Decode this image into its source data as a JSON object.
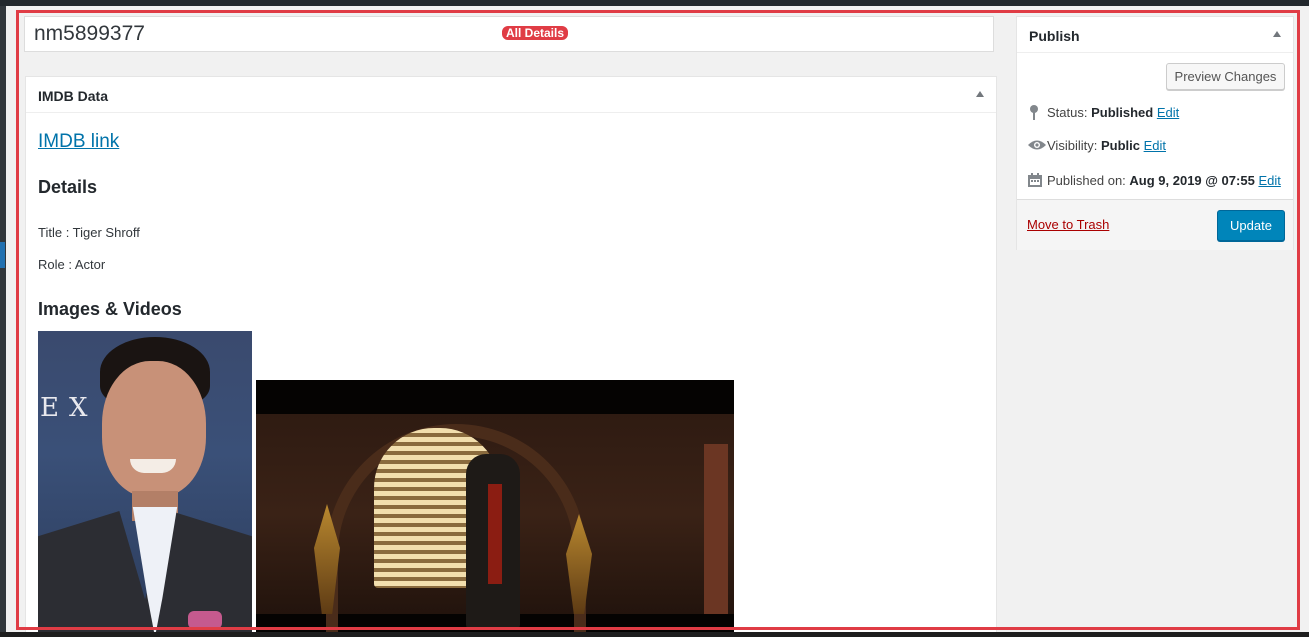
{
  "post": {
    "title_value": "nm5899377",
    "annotation_label": "All Details"
  },
  "imdb_box": {
    "heading": "IMDB Data",
    "link_text": "IMDB link",
    "details_heading": "Details",
    "title_line": "Title : Tiger Shroff",
    "role_line": "Role : Actor",
    "media_heading": "Images & Videos"
  },
  "publish": {
    "heading": "Publish",
    "preview_label": "Preview Changes",
    "status_label": "Status:",
    "status_value": "Published",
    "visibility_label": "Visibility:",
    "visibility_value": "Public",
    "published_on_label": "Published on:",
    "published_on_value": "Aug 9, 2019 @ 07:55",
    "edit_label": "Edit",
    "trash_label": "Move to Trash",
    "update_label": "Update"
  },
  "icons": {
    "status": "pin-icon",
    "visibility": "eye-icon",
    "date": "calendar-icon",
    "toggle": "triangle-up-icon"
  },
  "colors": {
    "accent": "#0085ba",
    "link": "#0073aa",
    "trash": "#aa0000",
    "annotation": "#e03c45"
  }
}
